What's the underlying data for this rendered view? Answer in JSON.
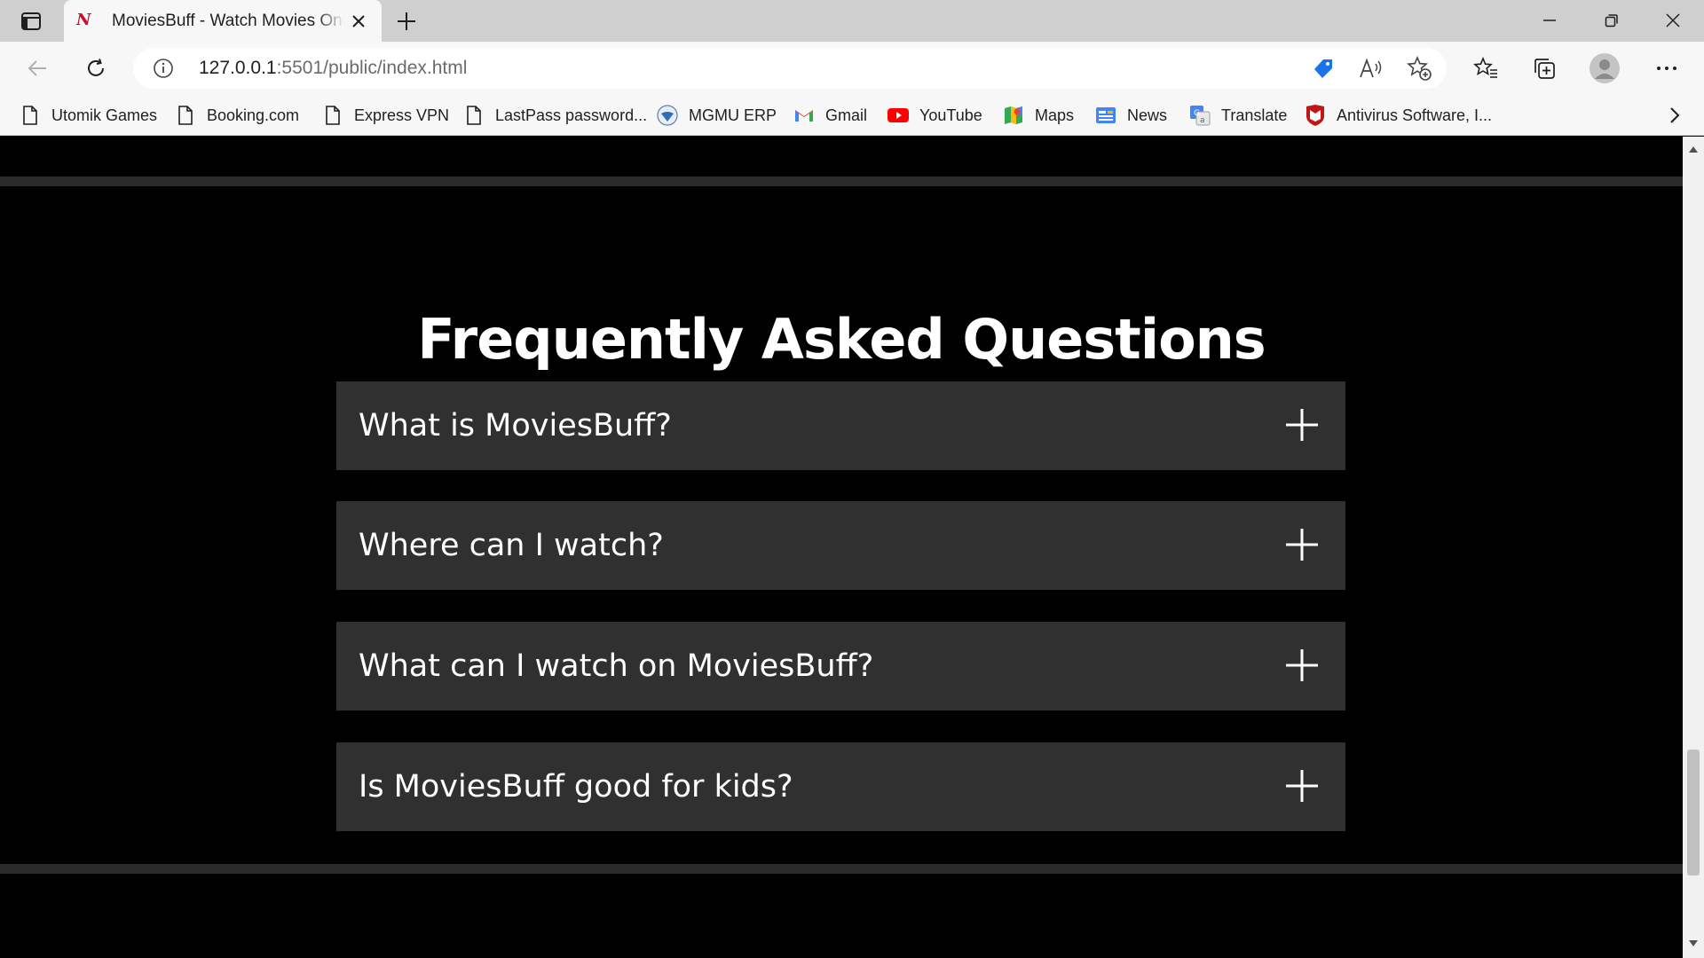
{
  "browser": {
    "tab": {
      "favicon_text": "N",
      "title": "MoviesBuff - Watch Movies Online"
    },
    "url_host": "127.0.0.1",
    "url_rest": ":5501/public/index.html",
    "bookmarks": [
      {
        "label": "Utomik Games",
        "icon": "page-icon"
      },
      {
        "label": "Booking.com",
        "icon": "page-icon"
      },
      {
        "label": "Express VPN",
        "icon": "page-icon"
      },
      {
        "label": "LastPass password...",
        "icon": "page-icon"
      },
      {
        "label": "MGMU ERP",
        "icon": "globe-badge-icon"
      },
      {
        "label": "Gmail",
        "icon": "gmail-icon"
      },
      {
        "label": "YouTube",
        "icon": "youtube-icon"
      },
      {
        "label": "Maps",
        "icon": "maps-icon"
      },
      {
        "label": "News",
        "icon": "news-icon"
      },
      {
        "label": "Translate",
        "icon": "translate-icon"
      },
      {
        "label": "Antivirus Software, I...",
        "icon": "mcafee-icon"
      }
    ]
  },
  "page": {
    "faq_title": "Frequently Asked Questions",
    "faq_items": [
      {
        "question": "What is MoviesBuff?"
      },
      {
        "question": "Where can I watch?"
      },
      {
        "question": "What can I watch on MoviesBuff?"
      },
      {
        "question": "Is MoviesBuff good for kids?"
      }
    ]
  },
  "colors": {
    "page_background": "#000000",
    "faq_item_background": "#303030",
    "divider": "#2b2b2b",
    "accent_red": "#c8102e"
  }
}
